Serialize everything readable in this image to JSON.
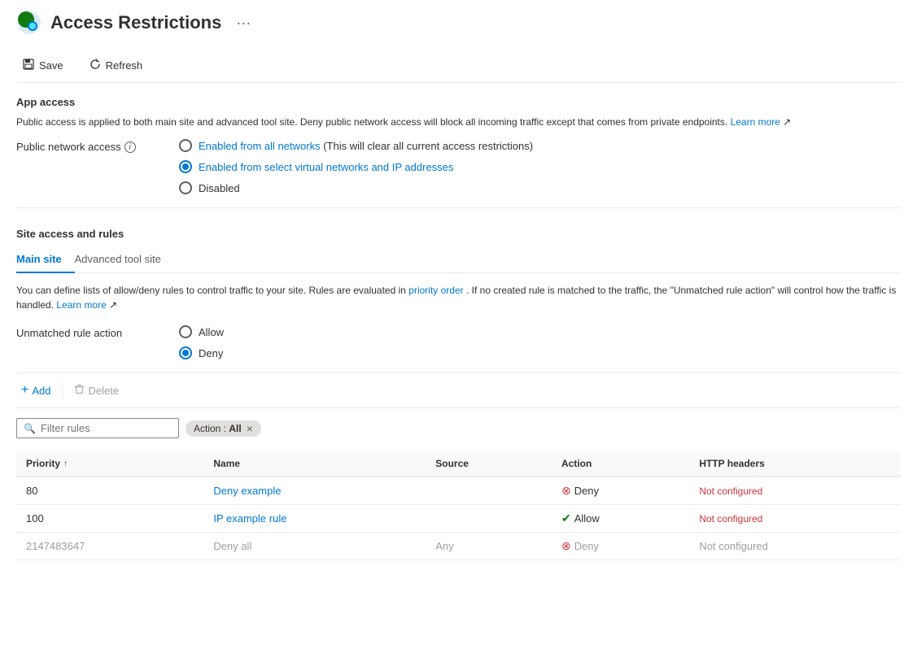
{
  "header": {
    "title": "Access Restrictions",
    "more_options_label": "···"
  },
  "toolbar": {
    "save_label": "Save",
    "refresh_label": "Refresh"
  },
  "app_access": {
    "section_title": "App access",
    "info_text": "Public access is applied to both main site and advanced tool site. Deny public network access will block all incoming traffic except that comes from private endpoints.",
    "learn_more_label": "Learn more",
    "public_network_label": "Public network access",
    "info_icon_title": "More info",
    "options": [
      {
        "id": "opt1",
        "label_plain": "Enabled from all networks",
        "label_suffix": " (This will clear all current access restrictions)",
        "checked": false,
        "has_blue_text": true
      },
      {
        "id": "opt2",
        "label_prefix": "Enabled from select ",
        "label_blue1": "virtual networks",
        "label_middle": " and ",
        "label_blue2": "IP addresses",
        "checked": true,
        "has_blue_text": true
      },
      {
        "id": "opt3",
        "label": "Disabled",
        "checked": false,
        "has_blue_text": false
      }
    ]
  },
  "site_access": {
    "section_title": "Site access and rules",
    "tabs": [
      {
        "id": "main",
        "label": "Main site",
        "active": true
      },
      {
        "id": "advanced",
        "label": "Advanced tool site",
        "active": false
      }
    ],
    "description": "You can define lists of allow/deny rules to control traffic to your site. Rules are evaluated in priority order. If no created rule is matched to the traffic, the \"Unmatched rule action\" will control how the traffic is handled.",
    "learn_more_label": "Learn more",
    "unmatched_rule_label": "Unmatched rule action",
    "unmatched_options": [
      {
        "id": "allow",
        "label": "Allow",
        "checked": false
      },
      {
        "id": "deny",
        "label": "Deny",
        "checked": true
      }
    ]
  },
  "actions": {
    "add_label": "Add",
    "delete_label": "Delete"
  },
  "filter": {
    "placeholder": "Filter rules",
    "tag": {
      "prefix": "Action : ",
      "value": "All"
    }
  },
  "table": {
    "columns": [
      {
        "id": "priority",
        "label": "Priority",
        "sortable": true,
        "sort_dir": "asc"
      },
      {
        "id": "name",
        "label": "Name"
      },
      {
        "id": "source",
        "label": "Source"
      },
      {
        "id": "action",
        "label": "Action"
      },
      {
        "id": "http_headers",
        "label": "HTTP headers"
      }
    ],
    "rows": [
      {
        "priority": "80",
        "name": "Deny example",
        "source": "",
        "action": "Deny",
        "action_type": "deny",
        "http_headers": "Not configured",
        "muted": false
      },
      {
        "priority": "100",
        "name": "IP example rule",
        "source": "",
        "action": "Allow",
        "action_type": "allow",
        "http_headers": "Not configured",
        "muted": false
      },
      {
        "priority": "2147483647",
        "name": "Deny all",
        "source": "Any",
        "action": "Deny",
        "action_type": "deny",
        "http_headers": "Not configured",
        "muted": true
      }
    ]
  }
}
